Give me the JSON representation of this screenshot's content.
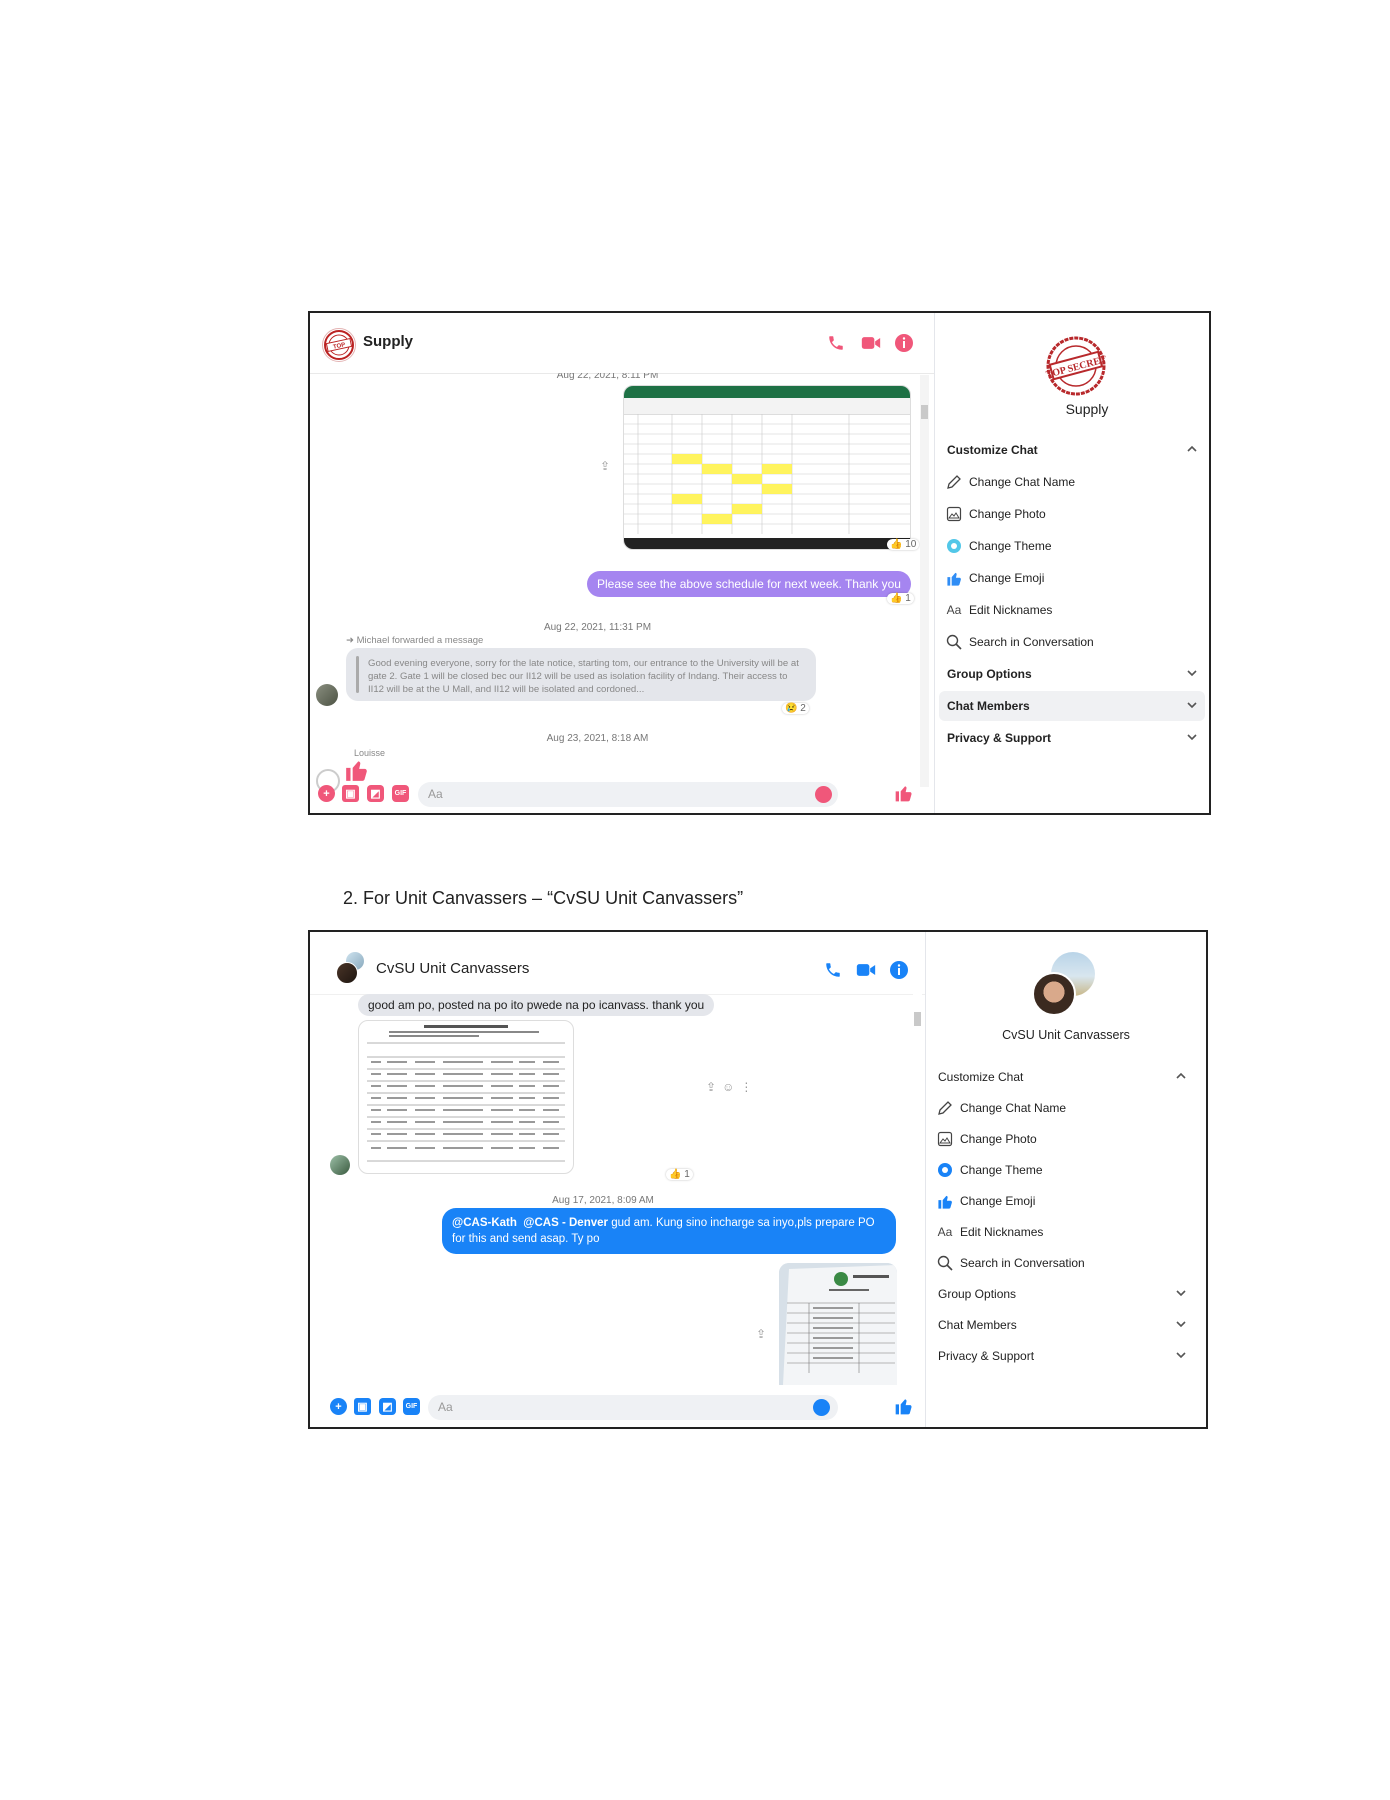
{
  "colors": {
    "messenger_blue": "#1983f7",
    "messenger_pink": "#f0577a",
    "purple_bubble": "#a585f0",
    "excel_green": "#1e7145"
  },
  "screenshot1": {
    "header": {
      "title": "Supply",
      "phone_icon": "phone-icon",
      "video_icon": "video-icon",
      "info_icon": "info-icon"
    },
    "messages": {
      "date1": "Aug 22, 2021, 8:11 PM",
      "image_reaction": "10",
      "outgoing_text": "Please see the above schedule for next week. Thank you",
      "outgoing_reaction": "1",
      "date2": "Aug 22, 2021, 11:31 PM",
      "forwarded_label": "Michael forwarded a message",
      "forwarded_text": "Good evening everyone, sorry for the late notice, starting tom, our entrance to the University will be at gate 2. Gate 1 will be closed bec our II12 will be used as isolation facility of Indang. Their access to II12 will be at the U Mall, and II12 will be isolated and cordoned...",
      "forwarded_reaction": "2",
      "date3": "Aug 23, 2021, 8:18 AM",
      "sender_label": "Louisse"
    },
    "composer": {
      "placeholder": "Aa",
      "gif_label": "GIF"
    },
    "sidebar": {
      "name": "Supply",
      "customize_label": "Customize Chat",
      "items": [
        {
          "label": "Change Chat Name",
          "icon": "pencil-icon"
        },
        {
          "label": "Change Photo",
          "icon": "image-icon"
        },
        {
          "label": "Change Theme",
          "icon": "theme-circle-icon"
        },
        {
          "label": "Change Emoji",
          "icon": "thumbs-up-icon"
        },
        {
          "label": "Edit Nicknames",
          "icon": "text-aa-icon"
        },
        {
          "label": "Search in Conversation",
          "icon": "search-icon"
        }
      ],
      "group_options": "Group Options",
      "chat_members": "Chat Members",
      "privacy_support": "Privacy & Support"
    }
  },
  "caption": "2.   For Unit Canvassers – “CvSU Unit Canvassers”",
  "screenshot2": {
    "header": {
      "title": "CvSU Unit Canvassers",
      "phone_icon": "phone-icon",
      "video_icon": "video-icon",
      "info_icon": "info-icon"
    },
    "messages": {
      "incoming_text": "good am po, posted na po ito pwede na po icanvass. thank you",
      "doc_reaction": "1",
      "date1": "Aug 17, 2021, 8:09 AM",
      "mention1": "@CAS-Kath",
      "mention2": "@CAS - Denver",
      "outgoing_text": " gud am. Kung sino incharge sa inyo,pls prepare PO for this and send asap. Ty po"
    },
    "composer": {
      "placeholder": "Aa",
      "gif_label": "GIF"
    },
    "sidebar": {
      "name": "CvSU Unit Canvassers",
      "customize_label": "Customize Chat",
      "items": [
        {
          "label": "Change Chat Name",
          "icon": "pencil-icon"
        },
        {
          "label": "Change Photo",
          "icon": "image-icon"
        },
        {
          "label": "Change Theme",
          "icon": "theme-circle-icon"
        },
        {
          "label": "Change Emoji",
          "icon": "thumbs-up-icon"
        },
        {
          "label": "Edit Nicknames",
          "icon": "text-aa-icon"
        },
        {
          "label": "Search in Conversation",
          "icon": "search-icon"
        }
      ],
      "group_options": "Group Options",
      "chat_members": "Chat Members",
      "privacy_support": "Privacy & Support"
    }
  }
}
